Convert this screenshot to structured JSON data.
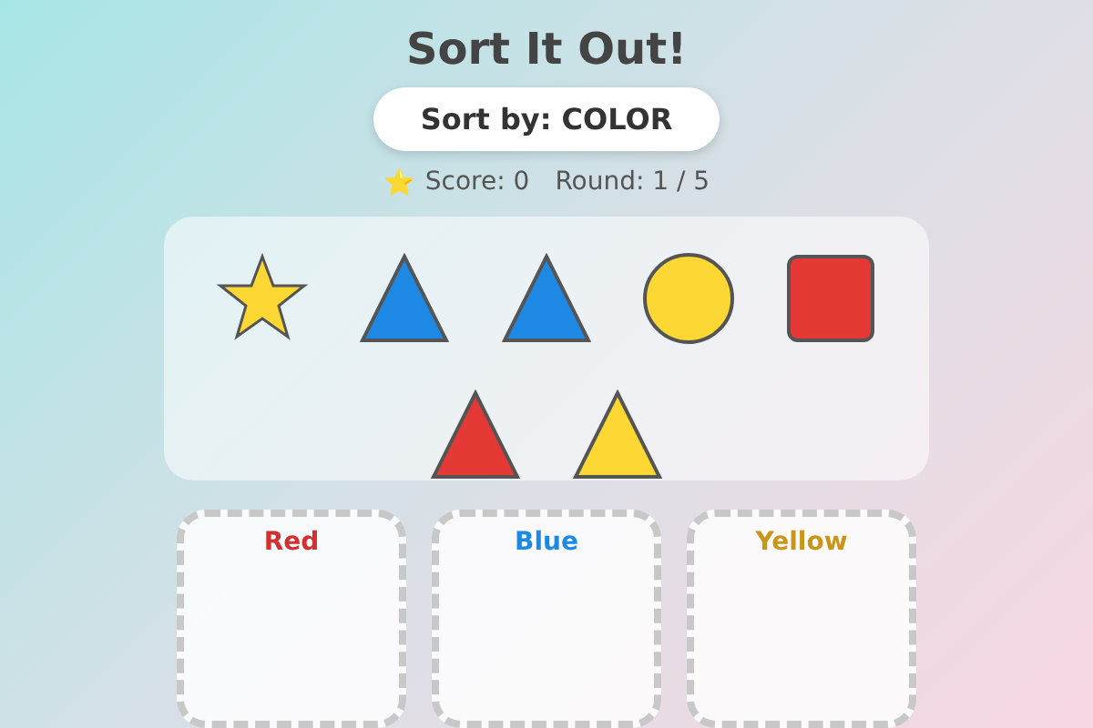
{
  "title": "Sort It Out!",
  "sort_by": "Sort by: COLOR",
  "stats": {
    "icon": "⭐",
    "score": "Score: 0",
    "round": "Round: 1 / 5"
  },
  "shapes": [
    {
      "kind": "star",
      "color": "#fdd835"
    },
    {
      "kind": "triangle",
      "color": "#1e88e5"
    },
    {
      "kind": "triangle",
      "color": "#1e88e5"
    },
    {
      "kind": "circle",
      "color": "#fdd835"
    },
    {
      "kind": "square",
      "color": "#e53935"
    },
    {
      "kind": "triangle",
      "color": "#e53935"
    },
    {
      "kind": "triangle",
      "color": "#fdd835"
    }
  ],
  "bins": [
    {
      "label": "Red",
      "color": "#d32f2f"
    },
    {
      "label": "Blue",
      "color": "#1e88e5"
    },
    {
      "label": "Yellow",
      "color": "#c9961a"
    }
  ]
}
